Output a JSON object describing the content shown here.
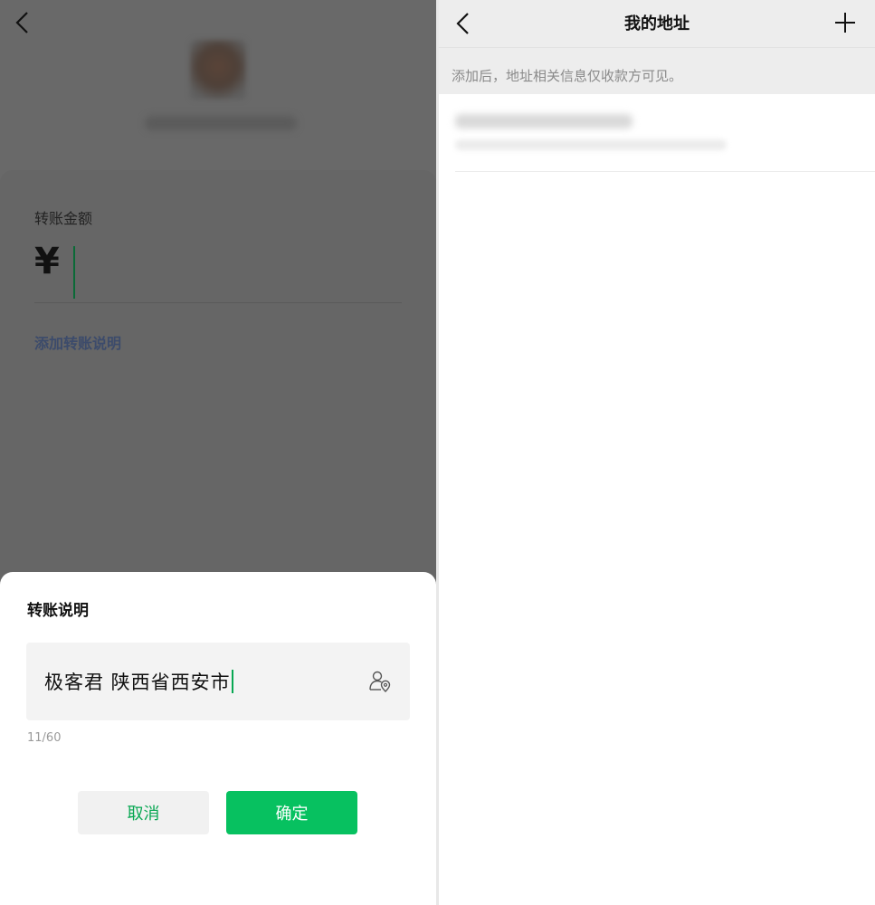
{
  "transfer_screen": {
    "amount_label": "转账金额",
    "currency_symbol": "¥",
    "add_note_link": "添加转账说明"
  },
  "note_sheet": {
    "title": "转账说明",
    "note_value": "极客君 陕西省西安市",
    "counter": "11/60",
    "cancel_label": "取消",
    "confirm_label": "确定"
  },
  "address_screen": {
    "title": "我的地址",
    "hint": "添加后，地址相关信息仅收款方可见。"
  },
  "icons": {
    "back": "chevron-left-icon",
    "add": "plus-icon",
    "address_picker": "person-location-icon"
  },
  "colors": {
    "accent_green": "#07c160",
    "link_blue": "#3c4b6b",
    "overlay_gray": "#696969"
  }
}
